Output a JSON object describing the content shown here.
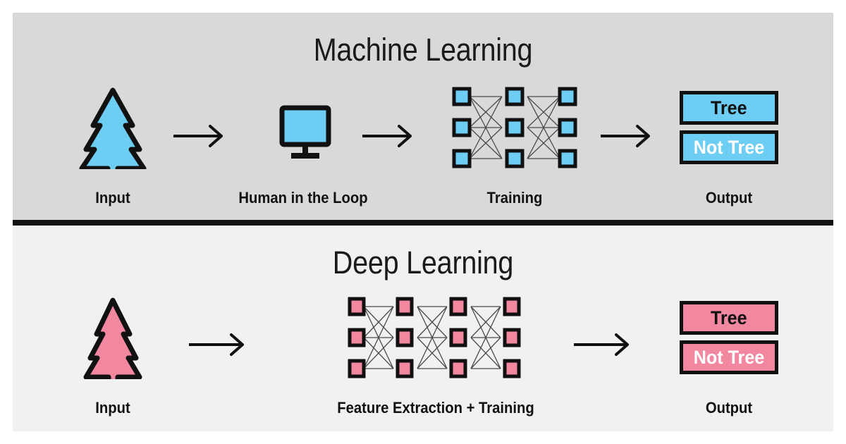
{
  "colors": {
    "ml_background": "#d9d9d9",
    "dl_background": "#f1f1f1",
    "ml_accent": "#6dcdf3",
    "dl_accent": "#f2889f",
    "outline": "#111111",
    "page_background": "#ffffff",
    "connection_line": "#4a4a4a",
    "connection_line_horizontal": "#8a8a8a"
  },
  "sections": [
    {
      "id": "machine-learning",
      "title": "Machine Learning",
      "accent": "#6dcdf3",
      "background": "#d9d9d9",
      "stages": [
        {
          "id": "input",
          "label": "Input",
          "art": "tree-icon"
        },
        {
          "id": "human-in-the-loop",
          "label": "Human in the Loop",
          "art": "monitor-icon"
        },
        {
          "id": "training",
          "label": "Training",
          "art": "neural-network",
          "columns": 3,
          "rows": 3
        },
        {
          "id": "output",
          "label": "Output",
          "art": "output-boxes"
        }
      ],
      "arrows": 3,
      "output_boxes": [
        {
          "id": "tree",
          "label": "Tree",
          "text_color": "#111111"
        },
        {
          "id": "not-tree",
          "label": "Not Tree",
          "text_color": "#ffffff"
        }
      ]
    },
    {
      "id": "deep-learning",
      "title": "Deep Learning",
      "accent": "#f2889f",
      "background": "#f1f1f1",
      "stages": [
        {
          "id": "input",
          "label": "Input",
          "art": "tree-icon"
        },
        {
          "id": "feature-extraction-training",
          "label": "Feature Extraction + Training",
          "art": "neural-network",
          "columns": 4,
          "rows": 3
        },
        {
          "id": "output",
          "label": "Output",
          "art": "output-boxes"
        }
      ],
      "arrows": 2,
      "output_boxes": [
        {
          "id": "tree",
          "label": "Tree",
          "text_color": "#111111"
        },
        {
          "id": "not-tree",
          "label": "Not Tree",
          "text_color": "#ffffff"
        }
      ]
    }
  ]
}
